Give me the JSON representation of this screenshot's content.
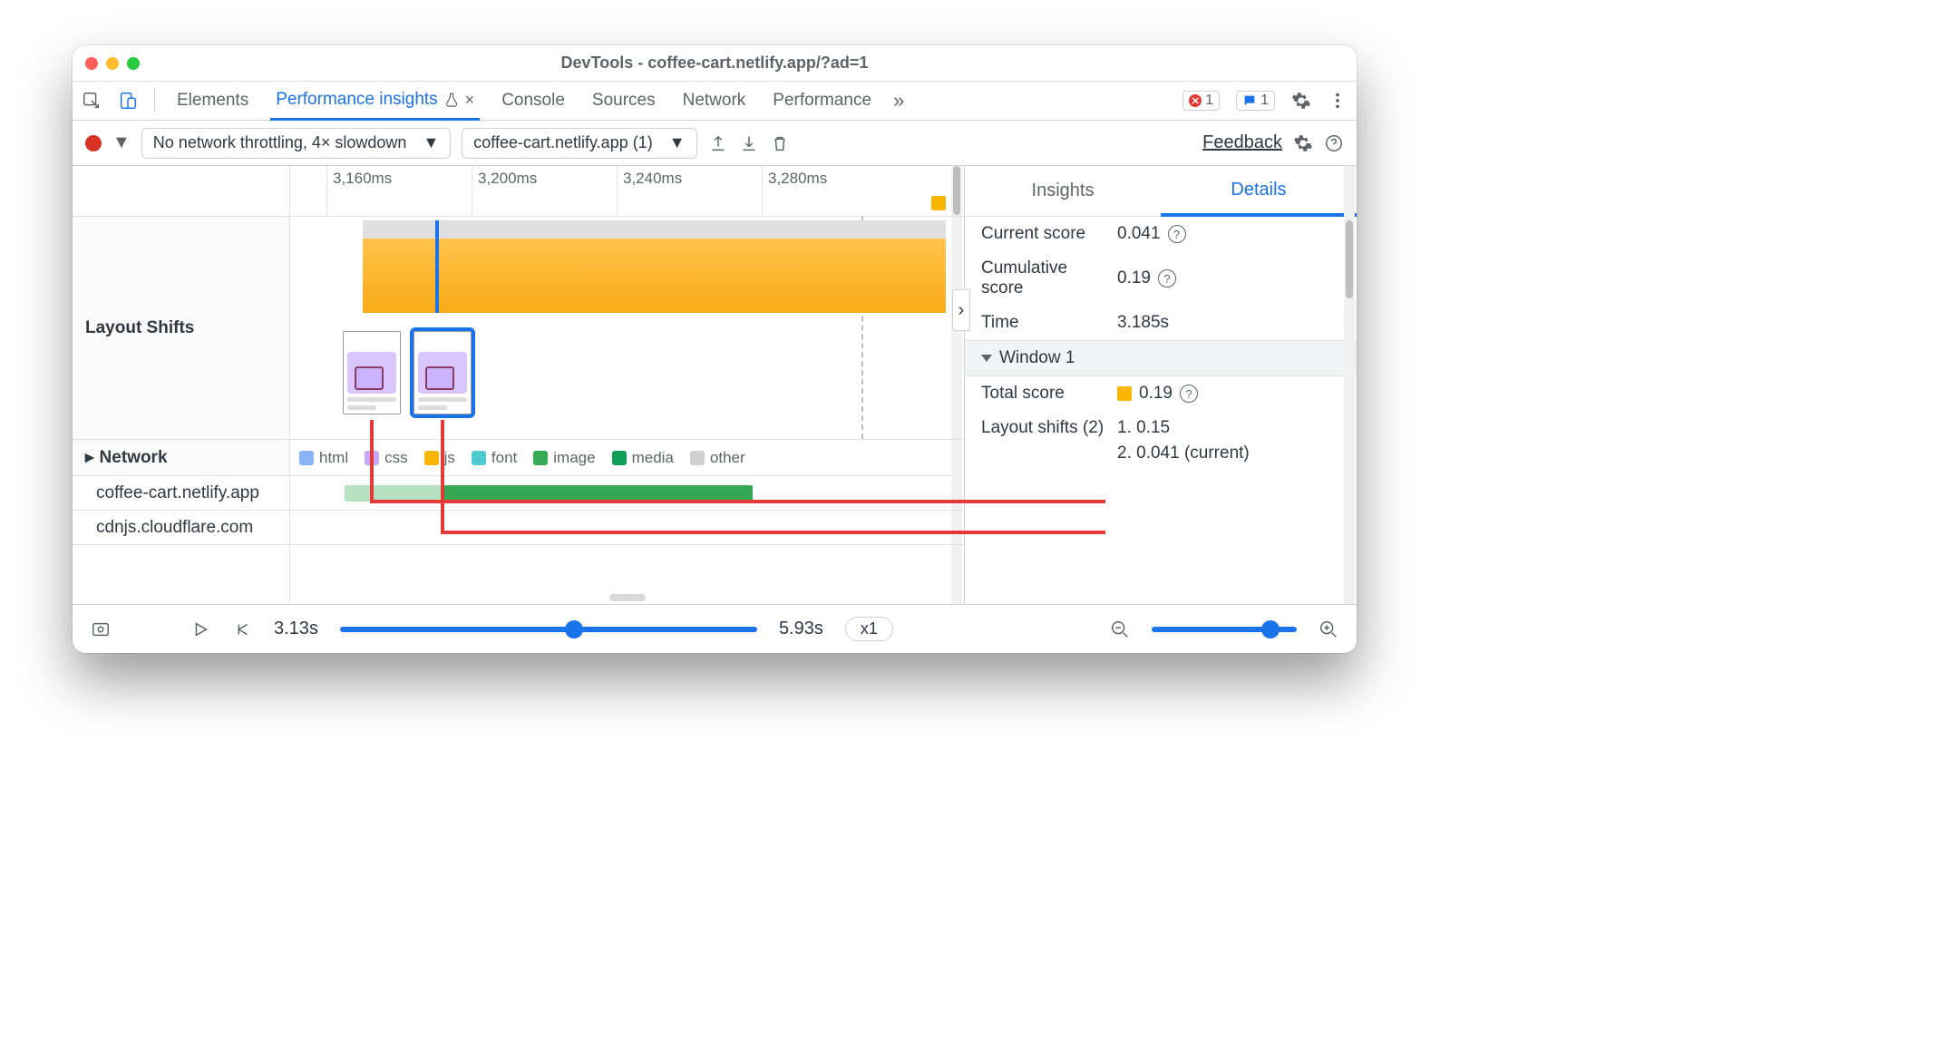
{
  "window": {
    "title": "DevTools - coffee-cart.netlify.app/?ad=1"
  },
  "tabs": {
    "elements": "Elements",
    "perf_insights": "Performance insights",
    "console": "Console",
    "sources": "Sources",
    "network": "Network",
    "performance": "Performance",
    "errors_count": "1",
    "messages_count": "1"
  },
  "toolbar": {
    "throttle": "No network throttling, 4× slowdown",
    "recording": "coffee-cart.netlify.app (1)",
    "feedback": "Feedback"
  },
  "ruler": {
    "ticks": [
      "3,160ms",
      "3,200ms",
      "3,240ms",
      "3,280ms"
    ]
  },
  "rows": {
    "layout_shifts": "Layout Shifts",
    "network": "Network",
    "hosts": [
      "coffee-cart.netlify.app",
      "cdnjs.cloudflare.com"
    ]
  },
  "legend": {
    "html": "html",
    "css": "css",
    "js": "js",
    "font": "font",
    "image": "image",
    "media": "media",
    "other": "other"
  },
  "details": {
    "tabs": {
      "insights": "Insights",
      "details": "Details"
    },
    "current_score_label": "Current score",
    "current_score": "0.041",
    "cumulative_label": "Cumulative score",
    "cumulative": "0.19",
    "time_label": "Time",
    "time": "3.185s",
    "window_label": "Window 1",
    "total_score_label": "Total score",
    "total_score": "0.19",
    "layout_shifts_label": "Layout shifts (2)",
    "shift1": "1. 0.15",
    "shift2": "2. 0.041 (current)"
  },
  "footer": {
    "time_start": "3.13s",
    "time_end": "5.93s",
    "speed": "x1"
  }
}
